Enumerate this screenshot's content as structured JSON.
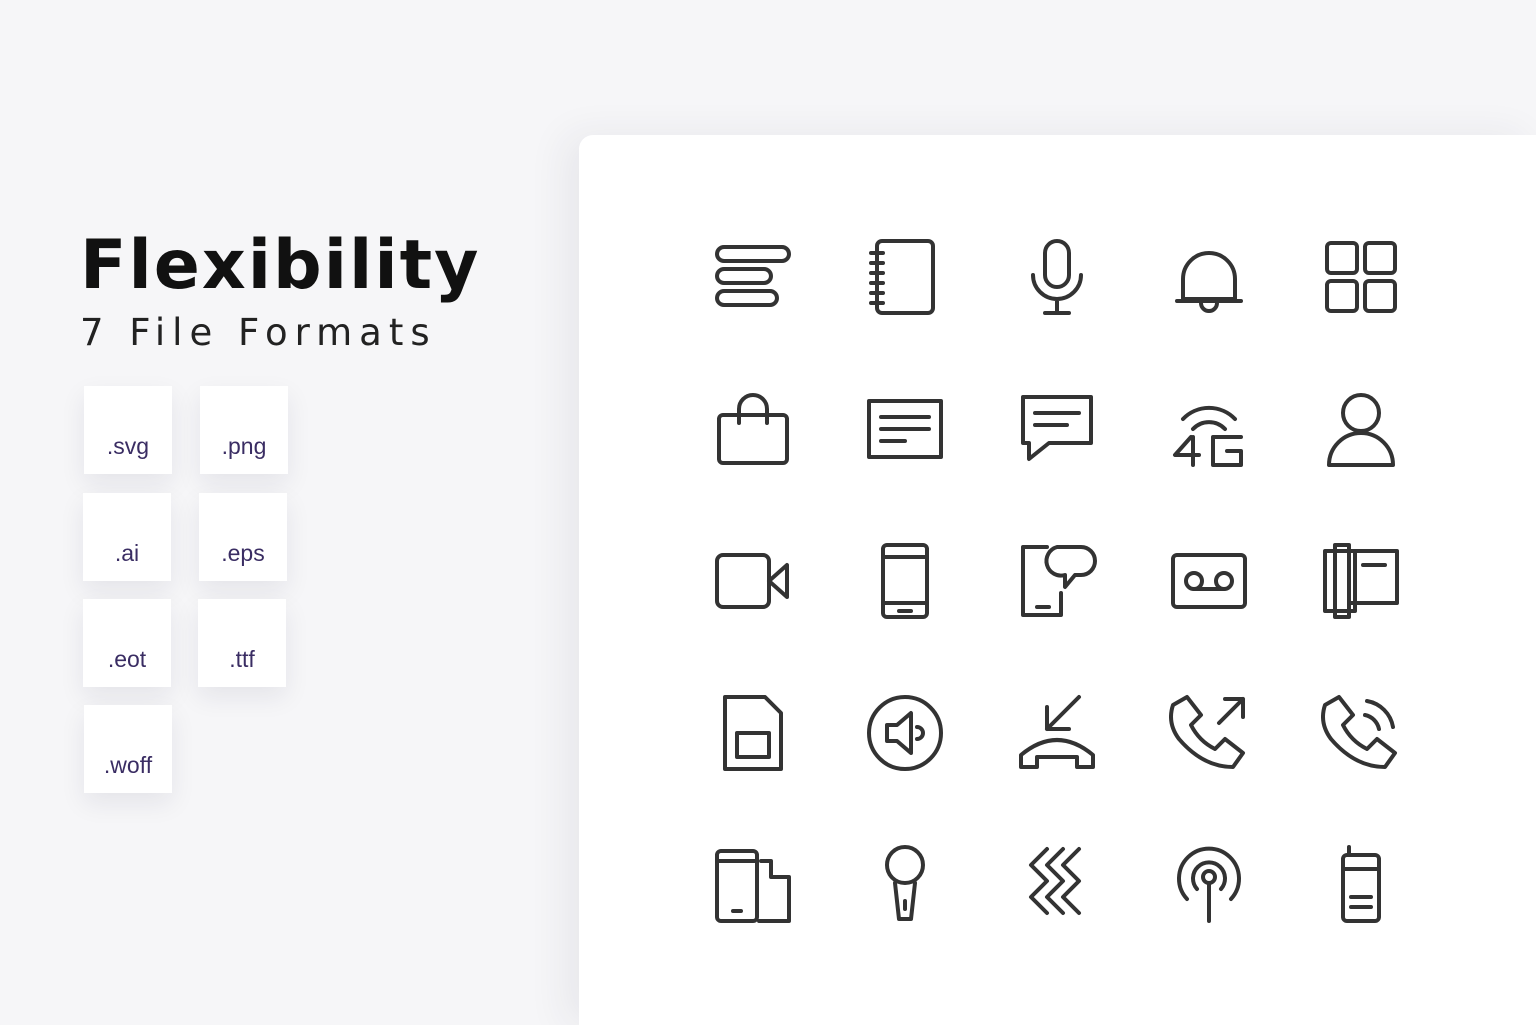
{
  "header": {
    "title": "Flexibility",
    "subtitle": "7 File Formats"
  },
  "formats": [
    ".svg",
    ".png",
    ".ai",
    ".eps",
    ".eot",
    ".ttf",
    ".woff"
  ],
  "icons": [
    [
      "text-align-icon",
      "notebook-icon",
      "microphone-icon",
      "bell-icon",
      "grid-icon"
    ],
    [
      "shopping-bag-icon",
      "message-box-icon",
      "chat-bubble-icon",
      "4g-signal-icon",
      "user-icon"
    ],
    [
      "video-camera-icon",
      "smartphone-icon",
      "phone-chat-icon",
      "voicemail-icon",
      "phone-book-icon"
    ],
    [
      "sim-card-icon",
      "speaker-icon",
      "missed-call-icon",
      "outgoing-call-icon",
      "phone-ringing-icon"
    ],
    [
      "devices-icon",
      "handheld-mic-icon",
      "vibration-icon",
      "broadcast-icon",
      "walkie-talkie-icon"
    ]
  ],
  "colors": {
    "background": "#f6f6f8",
    "panel": "#ffffff",
    "icon_stroke": "#333333",
    "format_text": "#3a2d63"
  }
}
